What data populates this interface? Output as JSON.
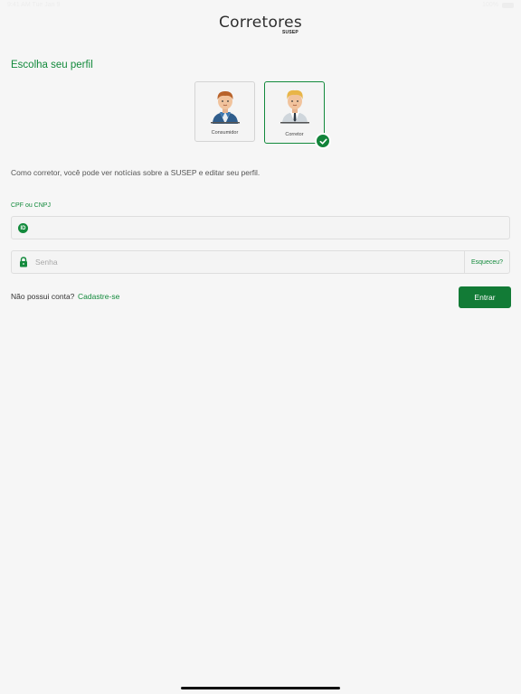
{
  "status_bar": {
    "time": "9:41 AM  Tue Jan 9",
    "battery": "100%"
  },
  "logo": {
    "title": "Corretores",
    "subtitle": "SUSEP"
  },
  "profile": {
    "title": "Escolha seu perfil",
    "options": [
      {
        "label": "Consumidor",
        "selected": false
      },
      {
        "label": "Corretor",
        "selected": true
      }
    ],
    "description": "Como corretor, você pode ver notícias sobre a SUSEP e editar seu perfil."
  },
  "form": {
    "cpf_label": "CPF ou CNPJ",
    "cpf_value": "",
    "id_icon_text": "ID",
    "password_placeholder": "Senha",
    "password_value": "",
    "forgot_label": "Esqueceu?"
  },
  "footer": {
    "no_account_text": "Não possui conta?",
    "signup_label": "Cadastre-se",
    "submit_label": "Entrar"
  },
  "colors": {
    "accent": "#138a3c",
    "button": "#127b36",
    "background": "#f6f6f6"
  }
}
